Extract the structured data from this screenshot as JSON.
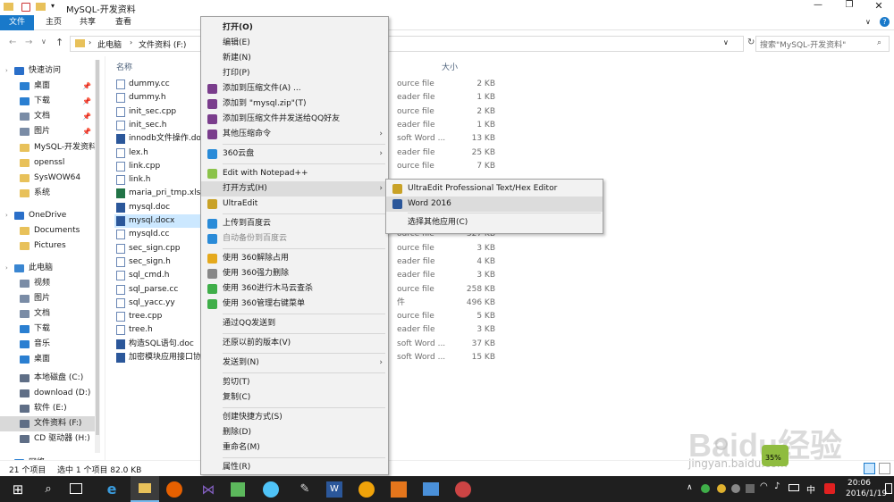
{
  "window": {
    "title": "MySQL-开发资料"
  },
  "ribbon": {
    "tabs": [
      "文件",
      "主页",
      "共享",
      "查看"
    ]
  },
  "address": {
    "path": [
      "此电脑",
      "文件资料 (F:)"
    ],
    "search_placeholder": "搜索\"MySQL-开发资料\""
  },
  "nav": {
    "items": [
      {
        "label": "快速访问",
        "icon": "star-icon",
        "color": "#2a6fc9"
      },
      {
        "label": "桌面",
        "icon": "desktop-icon",
        "color": "#2a7fd1"
      },
      {
        "label": "下载",
        "icon": "download-icon",
        "color": "#2a7fd1"
      },
      {
        "label": "文档",
        "icon": "document-icon",
        "color": "#7a8ca6"
      },
      {
        "label": "图片",
        "icon": "picture-icon",
        "color": "#7a8ca6"
      },
      {
        "label": "MySQL-开发资料",
        "icon": "folder-icon",
        "color": "#e8c15a"
      },
      {
        "label": "openssl",
        "icon": "folder-icon",
        "color": "#e8c15a"
      },
      {
        "label": "SysWOW64",
        "icon": "folder-icon",
        "color": "#e8c15a"
      },
      {
        "label": "系统",
        "icon": "folder-icon",
        "color": "#e8c15a"
      },
      {
        "label": "OneDrive",
        "icon": "cloud-icon",
        "color": "#2a6fc9"
      },
      {
        "label": "Documents",
        "icon": "folder-icon",
        "color": "#e8c15a"
      },
      {
        "label": "Pictures",
        "icon": "folder-icon",
        "color": "#e8c15a"
      },
      {
        "label": "此电脑",
        "icon": "computer-icon",
        "color": "#3a86d1"
      },
      {
        "label": "视频",
        "icon": "video-icon",
        "color": "#7a8ca6"
      },
      {
        "label": "图片",
        "icon": "picture-icon",
        "color": "#7a8ca6"
      },
      {
        "label": "文档",
        "icon": "document-icon",
        "color": "#7a8ca6"
      },
      {
        "label": "下载",
        "icon": "download-icon",
        "color": "#2a7fd1"
      },
      {
        "label": "音乐",
        "icon": "music-icon",
        "color": "#2a7fd1"
      },
      {
        "label": "桌面",
        "icon": "desktop-icon",
        "color": "#2a7fd1"
      },
      {
        "label": "本地磁盘 (C:)",
        "icon": "drive-icon",
        "color": "#5f6e86"
      },
      {
        "label": "download (D:)",
        "icon": "drive-icon",
        "color": "#5f6e86"
      },
      {
        "label": "软件 (E:)",
        "icon": "drive-icon",
        "color": "#5f6e86"
      },
      {
        "label": "文件资料 (F:)",
        "icon": "drive-icon",
        "color": "#5f6e86"
      },
      {
        "label": "CD 驱动器 (H:)",
        "icon": "cd-drive-icon",
        "color": "#5f6e86"
      },
      {
        "label": "网络",
        "icon": "network-icon",
        "color": "#2a7fd1"
      }
    ]
  },
  "content": {
    "headers": {
      "name": "名称",
      "size": "大小"
    },
    "files": [
      {
        "name": "dummy.cc",
        "type": "ource file",
        "size": "2 KB"
      },
      {
        "name": "dummy.h",
        "type": "eader file",
        "size": "1 KB"
      },
      {
        "name": "init_sec.cpp",
        "type": "ource file",
        "size": "2 KB"
      },
      {
        "name": "init_sec.h",
        "type": "eader file",
        "size": "1 KB"
      },
      {
        "name": "innodb文件操作.doc",
        "type": "soft Word ...",
        "size": "13 KB"
      },
      {
        "name": "lex.h",
        "type": "eader file",
        "size": "25 KB"
      },
      {
        "name": "link.cpp",
        "type": "ource file",
        "size": "7 KB"
      },
      {
        "name": "link.h",
        "type": "",
        "size": ""
      },
      {
        "name": "maria_pri_tmp.xls",
        "type": "",
        "size": ""
      },
      {
        "name": "mysql.doc",
        "type": "",
        "size": ""
      },
      {
        "name": "mysql.docx",
        "type": "",
        "size": ""
      },
      {
        "name": "mysqld.cc",
        "type": "ource file",
        "size": "327 KB"
      },
      {
        "name": "sec_sign.cpp",
        "type": "ource file",
        "size": "3 KB"
      },
      {
        "name": "sec_sign.h",
        "type": "eader file",
        "size": "4 KB"
      },
      {
        "name": "sql_cmd.h",
        "type": "eader file",
        "size": "3 KB"
      },
      {
        "name": "sql_parse.cc",
        "type": "ource file",
        "size": "258 KB"
      },
      {
        "name": "sql_yacc.yy",
        "type": "件",
        "size": "496 KB"
      },
      {
        "name": "tree.cpp",
        "type": "ource file",
        "size": "5 KB"
      },
      {
        "name": "tree.h",
        "type": "eader file",
        "size": "3 KB"
      },
      {
        "name": "构造SQL语句.doc",
        "type": "soft Word ...",
        "size": "37 KB"
      },
      {
        "name": "加密模块应用接口协",
        "type": "soft Word ...",
        "size": "15 KB"
      }
    ]
  },
  "status": {
    "count": "21 个项目",
    "selected": "选中 1 个项目 82.0 KB"
  },
  "context_menu": {
    "items": [
      {
        "label": "打开(O)",
        "bold": true
      },
      {
        "label": "编辑(E)"
      },
      {
        "label": "新建(N)"
      },
      {
        "label": "打印(P)"
      },
      {
        "label": "添加到压缩文件(A) ...",
        "icon": "winrar-icon"
      },
      {
        "label": "添加到 \"mysql.zip\"(T)",
        "icon": "winrar-icon"
      },
      {
        "label": "添加到压缩文件并发送给QQ好友",
        "icon": "winrar-icon"
      },
      {
        "label": "其他压缩命令",
        "icon": "winrar-icon",
        "submenu": true
      },
      {
        "sep": true
      },
      {
        "label": "360云盘",
        "icon": "cloud360-icon",
        "submenu": true
      },
      {
        "sep": true
      },
      {
        "label": "Edit with Notepad++",
        "icon": "notepad-icon"
      },
      {
        "label": "打开方式(H)",
        "submenu": true,
        "highlight": true
      },
      {
        "label": "UltraEdit",
        "icon": "ultraedit-icon"
      },
      {
        "sep": true
      },
      {
        "label": "上传到百度云",
        "icon": "baidu-cloud-icon"
      },
      {
        "label": "自动备份到百度云",
        "icon": "baidu-cloud-icon",
        "disabled": true
      },
      {
        "sep": true
      },
      {
        "label": "使用 360解除占用",
        "icon": "unlock360-icon"
      },
      {
        "label": "使用 360强力删除",
        "icon": "delete360-icon"
      },
      {
        "label": "使用 360进行木马云查杀",
        "icon": "shield360-icon"
      },
      {
        "label": "使用 360管理右键菜单",
        "icon": "shield360-icon"
      },
      {
        "sep": true
      },
      {
        "label": "通过QQ发送到"
      },
      {
        "sep": true
      },
      {
        "label": "还原以前的版本(V)"
      },
      {
        "sep": true
      },
      {
        "label": "发送到(N)",
        "submenu": true
      },
      {
        "sep": true
      },
      {
        "label": "剪切(T)"
      },
      {
        "label": "复制(C)"
      },
      {
        "sep": true
      },
      {
        "label": "创建快捷方式(S)"
      },
      {
        "label": "删除(D)"
      },
      {
        "label": "重命名(M)"
      },
      {
        "sep": true
      },
      {
        "label": "属性(R)"
      }
    ]
  },
  "submenu": {
    "items": [
      {
        "label": "UltraEdit Professional Text/Hex Editor",
        "icon": "ultraedit-icon"
      },
      {
        "label": "Word 2016",
        "icon": "word-icon",
        "highlight": true
      },
      {
        "label": "选择其他应用(C)"
      }
    ]
  },
  "taskbar": {
    "time": "20:06",
    "date": "2016/1/19",
    "ime": "中",
    "widget_percent": "35%"
  },
  "watermark": {
    "text": "Baidu经验",
    "url": "jingyan.baidu.com"
  },
  "colors": {
    "accent": "#1979ca",
    "selected_row": "#cce8ff",
    "menu_highlight": "#dcdcdc"
  }
}
